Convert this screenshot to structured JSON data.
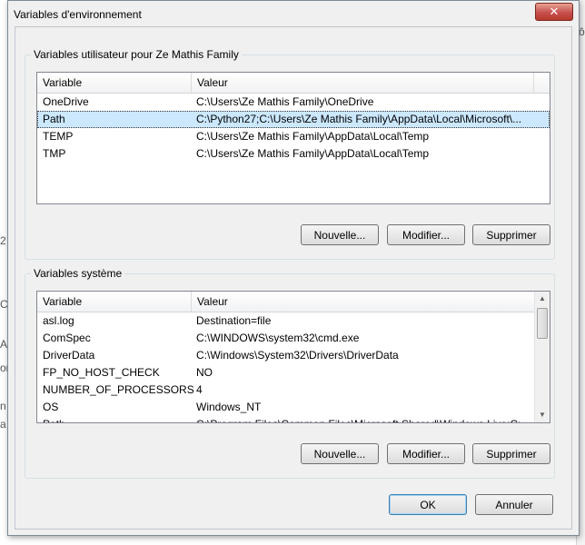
{
  "window": {
    "title": "Variables d'environnement",
    "close_glyph": "✕"
  },
  "user_vars": {
    "group_title": "Variables utilisateur pour Ze Mathis Family",
    "columns": [
      "Variable",
      "Valeur"
    ],
    "rows": [
      {
        "name": "OneDrive",
        "value": "C:\\Users\\Ze Mathis Family\\OneDrive"
      },
      {
        "name": "Path",
        "value": "C:\\Python27;C:\\Users\\Ze Mathis Family\\AppData\\Local\\Microsoft\\..."
      },
      {
        "name": "TEMP",
        "value": "C:\\Users\\Ze Mathis Family\\AppData\\Local\\Temp"
      },
      {
        "name": "TMP",
        "value": "C:\\Users\\Ze Mathis Family\\AppData\\Local\\Temp"
      }
    ],
    "selected_row": "Path",
    "buttons": {
      "new": "Nouvelle...",
      "edit": "Modifier...",
      "delete": "Supprimer"
    }
  },
  "system_vars": {
    "group_title": "Variables système",
    "columns": [
      "Variable",
      "Valeur"
    ],
    "rows": [
      {
        "name": "asl.log",
        "value": "Destination=file"
      },
      {
        "name": "ComSpec",
        "value": "C:\\WINDOWS\\system32\\cmd.exe"
      },
      {
        "name": "DriverData",
        "value": "C:\\Windows\\System32\\Drivers\\DriverData"
      },
      {
        "name": "FP_NO_HOST_CHECK",
        "value": "NO"
      },
      {
        "name": "NUMBER_OF_PROCESSORS",
        "value": "4"
      },
      {
        "name": "OS",
        "value": "Windows_NT"
      },
      {
        "name": "Path",
        "value": "C:\\Program Files\\Common Files\\Microsoft Shared\\Windows Live;C:..."
      }
    ],
    "buttons": {
      "new": "Nouvelle...",
      "edit": "Modifier...",
      "delete": "Supprimer"
    }
  },
  "footer": {
    "ok": "OK",
    "cancel": "Annuler"
  },
  "background_fragments": [
    "2",
    "C",
    "A",
    "or",
    "n",
    "a",
    "ô"
  ]
}
